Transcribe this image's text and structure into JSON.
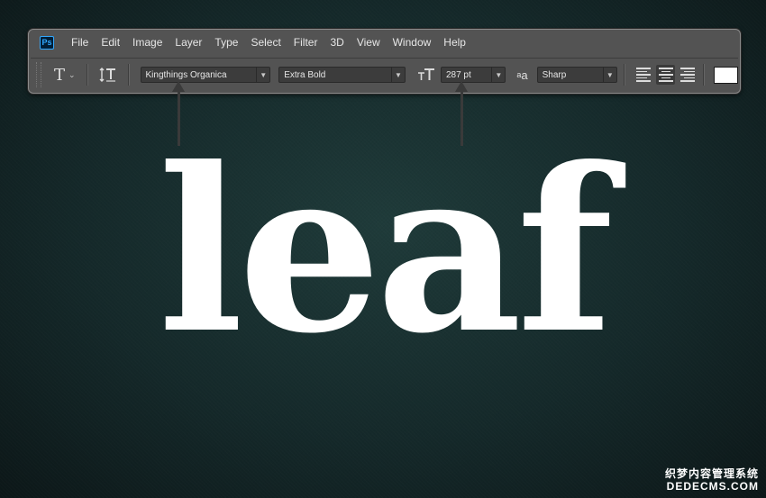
{
  "menubar": {
    "logo": "Ps",
    "items": [
      "File",
      "Edit",
      "Image",
      "Layer",
      "Type",
      "Select",
      "Filter",
      "3D",
      "View",
      "Window",
      "Help"
    ]
  },
  "options": {
    "tool_icon": "type-tool-icon",
    "font_family": "Kingthings Organica",
    "font_style": "Extra Bold",
    "font_size": "287 pt",
    "antialias": "Sharp",
    "text_color": "#ffffff"
  },
  "canvas": {
    "text": "leaf"
  },
  "watermark": {
    "line1": "织梦内容管理系统",
    "line2": "DEDECMS.COM"
  }
}
